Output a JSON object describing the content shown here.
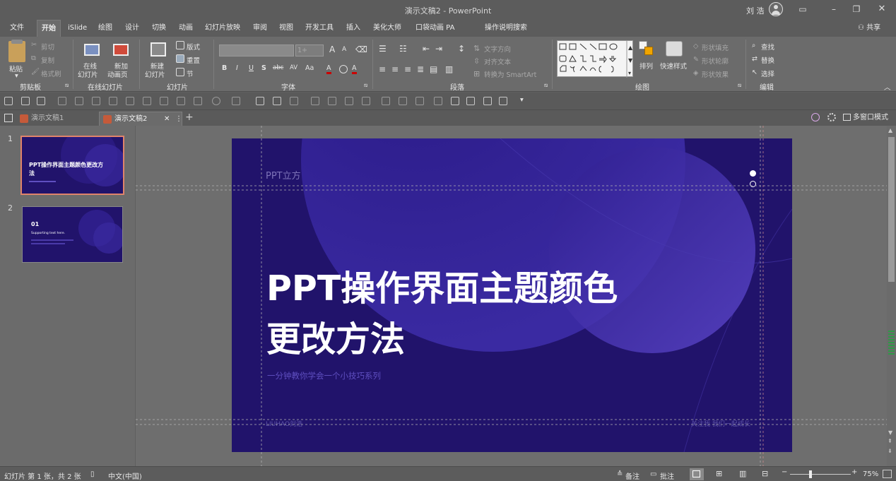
{
  "window": {
    "title": "演示文稿2  -  PowerPoint",
    "user": "刘 浩",
    "controls": [
      "ribbon-display-icon",
      "minimize-icon",
      "restore-icon",
      "close-icon"
    ]
  },
  "ribbon_tabs": [
    "文件",
    "开始",
    "iSlide",
    "绘图",
    "设计",
    "切换",
    "动画",
    "幻灯片放映",
    "审阅",
    "视图",
    "开发工具",
    "插入",
    "美化大师",
    "口袋动画 PA",
    "操作说明搜索"
  ],
  "share_label": "共享",
  "ribbon": {
    "clipboard": {
      "paste": "粘贴",
      "cut": "剪切",
      "copy": "复制",
      "format_painter": "格式刷",
      "label": "剪贴板"
    },
    "online": {
      "online_slides_1": "在线",
      "online_slides_2": "幻灯片",
      "new_anim_1": "新加",
      "new_anim_2": "动画页",
      "label": "在线幻灯片"
    },
    "slides": {
      "new_1": "新建",
      "new_2": "幻灯片",
      "layout": "版式",
      "reset": "重置",
      "section": "节",
      "label": "幻灯片"
    },
    "font": {
      "size_value": "1+",
      "label": "字体",
      "bold": "B",
      "italic": "I",
      "underline": "U",
      "shadow": "S",
      "strike": "abc",
      "spacing": "AV",
      "case": "Aa",
      "grow": "A",
      "shrink": "A"
    },
    "paragraph": {
      "text_direction": "文字方向",
      "align_text": "对齐文本",
      "convert_smartart": "转换为 SmartArt",
      "label": "段落"
    },
    "drawing": {
      "arrange": "排列",
      "quick_styles": "快速样式",
      "shape_fill": "形状填充",
      "shape_outline": "形状轮廓",
      "shape_effects": "形状效果",
      "label": "绘图"
    },
    "editing": {
      "find": "查找",
      "replace": "替换",
      "select": "选择",
      "label": "编辑"
    }
  },
  "doc_tabs": [
    {
      "label": "演示文稿1",
      "active": false
    },
    {
      "label": "演示文稿2",
      "active": true
    }
  ],
  "multiwindow_label": "多窗口模式",
  "thumbnails": [
    {
      "number": "1",
      "title": "PPT操作界面主题颜色更改方法",
      "selected": true
    },
    {
      "number": "2",
      "heading": "01",
      "subtitle": "Supporting text here.",
      "selected": false
    }
  ],
  "slide": {
    "brand": "PPT立方",
    "title_line1": "PPT操作界面主题颜色",
    "title_line2": "更改方法",
    "subtitle": "一分钟教你学会一个小技巧系列",
    "footer_left": "LIUHAO刘浩",
    "footer_right": "关注我 我们一起成长",
    "colors": {
      "background": "#21136b",
      "circle": "#3b2a9b",
      "accent_text": "#5f4fc0"
    }
  },
  "status": {
    "slide_count": "幻灯片 第 1 张，共 2 张",
    "language": "中文(中国)",
    "notes": "备注",
    "comments": "批注",
    "zoom": "75%"
  }
}
